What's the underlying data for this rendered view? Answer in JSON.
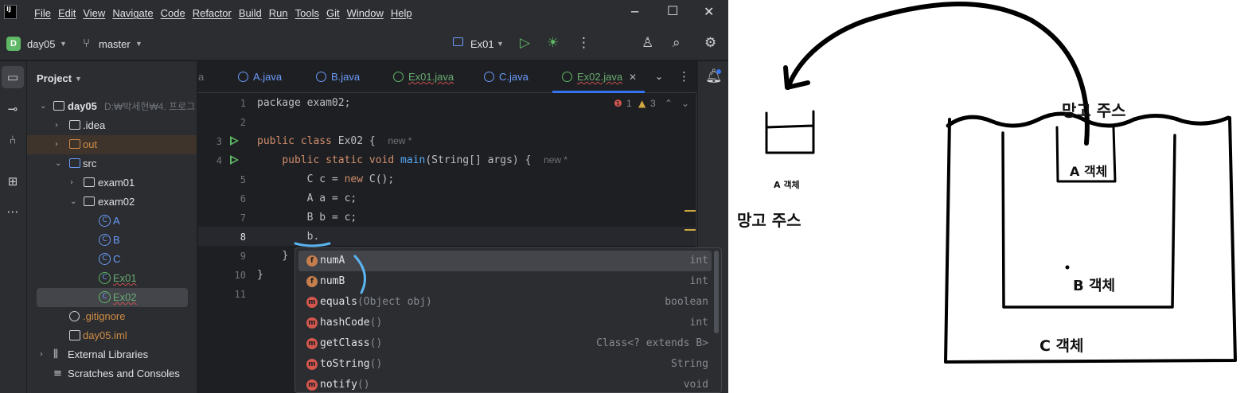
{
  "ide": {
    "logo_text": "IJ",
    "menu": [
      "File",
      "Edit",
      "View",
      "Navigate",
      "Code",
      "Refactor",
      "Build",
      "Run",
      "Tools",
      "Git",
      "Window",
      "Help"
    ],
    "toolbar": {
      "project_badge": "D",
      "project_name": "day05",
      "branch": "master",
      "run_config": "Ex01"
    },
    "project_panel": {
      "title": "Project",
      "root_name": "day05",
      "root_path": "D:₩박세현₩4. 프로그",
      "nodes": {
        "idea": ".idea",
        "out": "out",
        "src": "src",
        "exam01": "exam01",
        "exam02": "exam02",
        "class_a": "A",
        "class_b": "B",
        "class_c": "C",
        "ex01": "Ex01",
        "ex02": "Ex02",
        "gitignore": ".gitignore",
        "iml": "day05.iml",
        "ext_libs": "External Libraries",
        "scratches": "Scratches and Consoles"
      }
    },
    "tabs": {
      "partial": "a",
      "a": "A.java",
      "b": "B.java",
      "ex01": "Ex01.java",
      "c": "C.java",
      "ex02": "Ex02.java"
    },
    "editor": {
      "line_numbers": [
        "1",
        "2",
        "3",
        "4",
        "5",
        "6",
        "7",
        "8",
        "9",
        "10",
        "11"
      ],
      "errors": "1",
      "warnings": "3",
      "line1": "package exam02;",
      "line3_kw": "public class",
      "line3_rest": " Ex02 {",
      "hint_new": "new *",
      "line4_kw": "public static void",
      "line4_fn": "main",
      "line4_rest": "(String[] args) {",
      "line5_a": "C c = ",
      "line5_kw": "new",
      "line5_b": " C();",
      "line6": "A a = c;",
      "line7": "B b = c;",
      "line8": "b.",
      "line9": "}",
      "line10": "}"
    },
    "completion": [
      {
        "badge": "f",
        "name": "numA",
        "params": "",
        "type": "int"
      },
      {
        "badge": "f",
        "name": "numB",
        "params": "",
        "type": "int"
      },
      {
        "badge": "m",
        "name": "equals",
        "params": "(Object obj)",
        "type": "boolean"
      },
      {
        "badge": "m",
        "name": "hashCode",
        "params": "()",
        "type": "int"
      },
      {
        "badge": "m",
        "name": "getClass",
        "params": "()",
        "type": "Class<? extends B>"
      },
      {
        "badge": "m",
        "name": "toString",
        "params": "()",
        "type": "String"
      },
      {
        "badge": "m",
        "name": "notify",
        "params": "()",
        "type": "void"
      }
    ]
  },
  "drawing": {
    "label_a_small": "A 객체",
    "label_garbage_left": "망고 주스",
    "label_garbage_top": "망고 주스",
    "label_a_inner": "A 객체",
    "label_b": "B 객체",
    "label_c": "C 객체"
  }
}
